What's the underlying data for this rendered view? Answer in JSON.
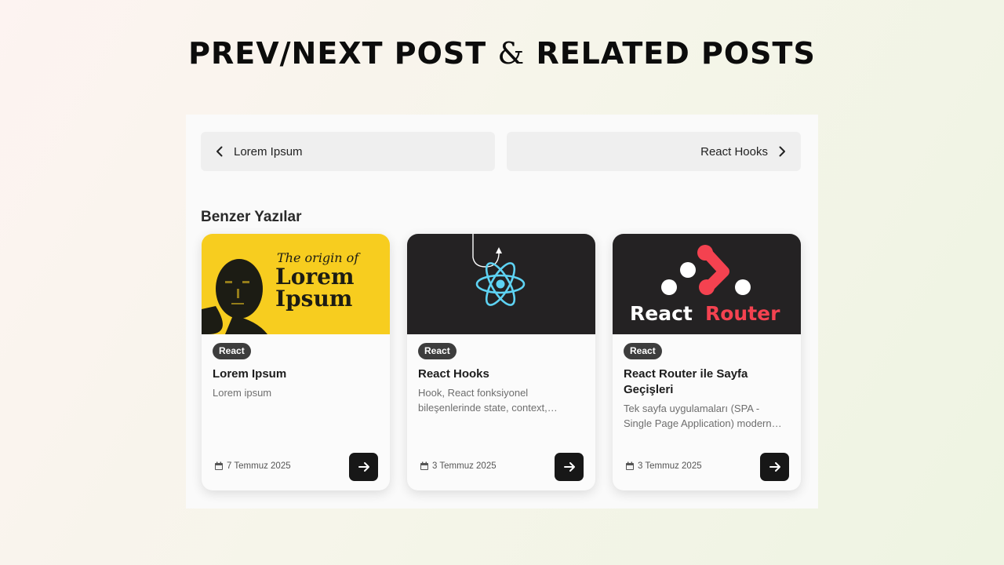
{
  "headline": {
    "part1": "PREV/NEXT POST ",
    "amp": "&",
    "part2": " RELATED POSTS"
  },
  "post_nav": {
    "prev": {
      "label": "Lorem Ipsum",
      "icon": "chevron-left-icon"
    },
    "next": {
      "label": "React Hooks",
      "icon": "chevron-right-icon"
    }
  },
  "related": {
    "title": "Benzer Yazılar",
    "cards": [
      {
        "image": {
          "line1": "The origin of",
          "line2": "Lorem",
          "line3": "Ipsum",
          "bg": "#f7cd1f"
        },
        "tag": "React",
        "title": "Lorem Ipsum",
        "desc": "Lorem ipsum",
        "date": "7 Temmuz 2025"
      },
      {
        "image": {
          "bg": "#242223",
          "accent": "#5ed3f3"
        },
        "tag": "React",
        "title": "React Hooks",
        "desc": "Hook, React fonksiyonel bileşenlerinde state, context, lifecycle gibi özelliklere erişmenizi sağlar.",
        "date": "3 Temmuz 2025"
      },
      {
        "image": {
          "word1": "React",
          "word2": "Router",
          "bg": "#242223",
          "accent": "#f44250"
        },
        "tag": "React",
        "title": "React Router ile Sayfa Geçişleri",
        "desc": "Tek sayfa uygulamaları (SPA - Single Page Application) modern web geliştirmede yaygındır.",
        "date": "3 Temmuz 2025"
      }
    ]
  }
}
